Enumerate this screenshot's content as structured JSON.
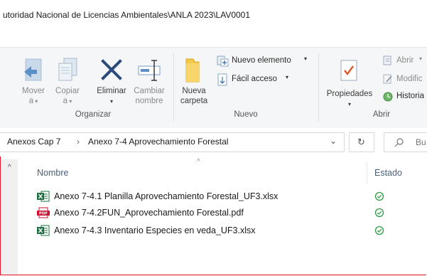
{
  "window": {
    "title": "utoridad Nacional de Licencias Ambientales\\ANLA 2023\\LAV0001"
  },
  "ribbon": {
    "organize": {
      "group_label": "Organizar",
      "move_to": {
        "line1": "Mover",
        "line2": "a"
      },
      "copy_to": {
        "line1": "Copiar",
        "line2": "a"
      },
      "delete": {
        "label": "Eliminar"
      },
      "rename": {
        "line1": "Cambiar",
        "line2": "nombre"
      }
    },
    "new": {
      "group_label": "Nuevo",
      "new_folder": {
        "line1": "Nueva",
        "line2": "carpeta"
      },
      "new_item": "Nuevo elemento",
      "easy_access": "Fácil acceso"
    },
    "open": {
      "group_label": "Abrir",
      "properties": "Propiedades",
      "open_item": "Abrir",
      "edit": "Modific",
      "history": "Historia"
    }
  },
  "address": {
    "crumb1": "Anexos Cap 7",
    "separator": "›",
    "crumb2": "Anexo 7-4 Aprovechamiento Forestal",
    "search_placeholder": "Bu"
  },
  "columns": {
    "name": "Nombre",
    "status": "Estado"
  },
  "files": [
    {
      "name": "Anexo 7-4.1 Planilla Aprovechamiento Forestal_UF3.xlsx",
      "type": "xlsx",
      "status": "synced"
    },
    {
      "name": "Anexo 7-4.2FUN_Aprovechamiento Forestal.pdf",
      "type": "pdf",
      "status": "synced"
    },
    {
      "name": "Anexo 7-4.3 Inventario Especies en veda_UF3.xlsx",
      "type": "xlsx",
      "status": "synced"
    }
  ],
  "colors": {
    "frame_border": "#e81123",
    "excel_green": "#1d6f42",
    "pdf_red": "#c8102e",
    "sync_green": "#2e9e44",
    "folder_yellow": "#f4c84a",
    "delete_blue": "#2b4a7c"
  }
}
